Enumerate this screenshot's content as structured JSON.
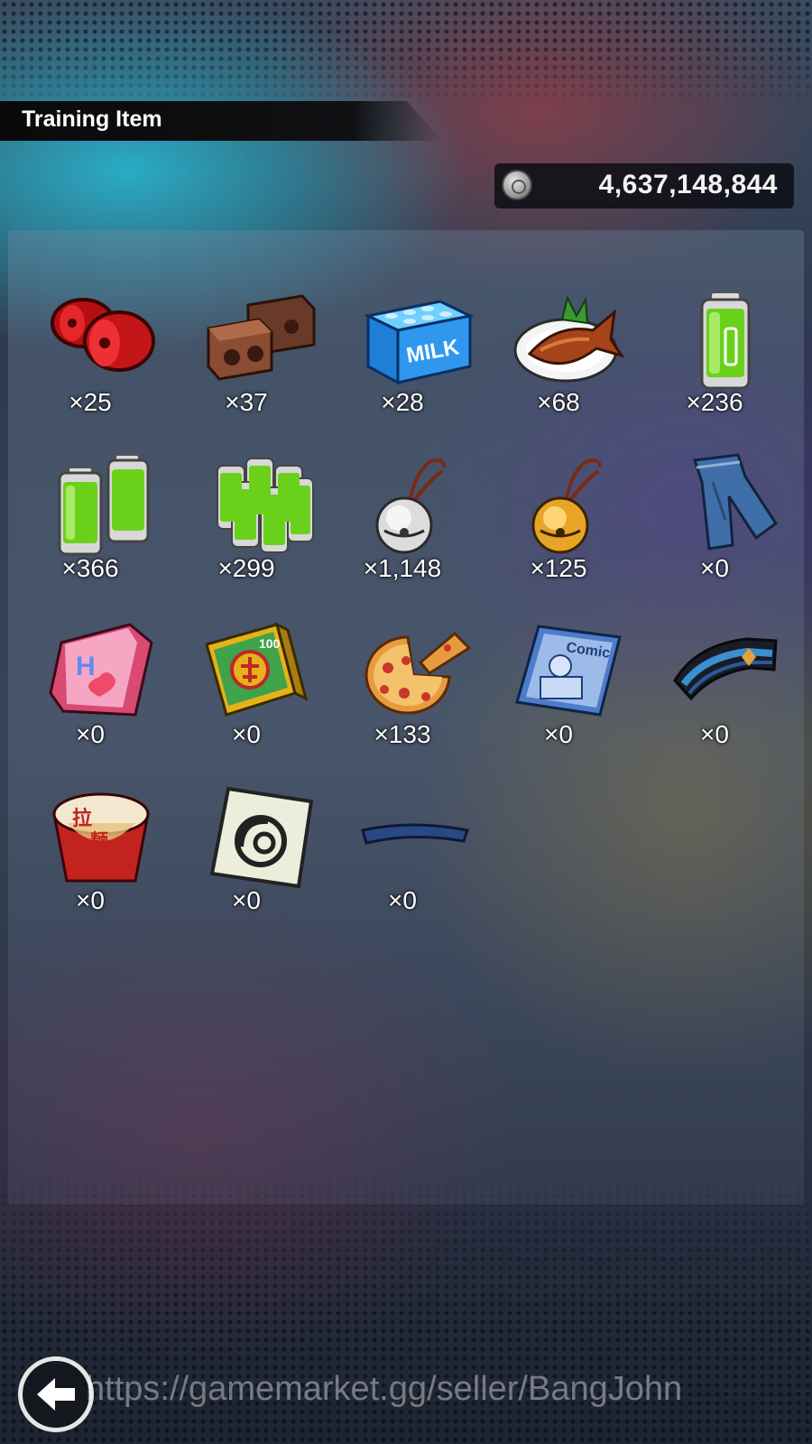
{
  "screen": {
    "title": "Training Item",
    "currency": {
      "icon": "coin-icon",
      "value": "4,637,148,844"
    },
    "watermark": "https://gamemarket.gg/seller/BangJohn",
    "back_icon": "back-arrow-icon"
  },
  "items": [
    {
      "name": "red-weights-icon",
      "count": "×25"
    },
    {
      "name": "brick-weights-icon",
      "count": "×37"
    },
    {
      "name": "milk-carton-icon",
      "count": "×28"
    },
    {
      "name": "grilled-fish-icon",
      "count": "×68"
    },
    {
      "name": "battery-icon",
      "count": "×236"
    },
    {
      "name": "double-battery-icon",
      "count": "×366"
    },
    {
      "name": "battery-pack-icon",
      "count": "×299"
    },
    {
      "name": "silver-bell-icon",
      "count": "×1,148"
    },
    {
      "name": "gold-bell-icon",
      "count": "×125"
    },
    {
      "name": "jeans-icon",
      "count": "×0"
    },
    {
      "name": "love-book-icon",
      "count": "×0"
    },
    {
      "name": "joke-book-icon",
      "count": "×0"
    },
    {
      "name": "pizza-icon",
      "count": "×133"
    },
    {
      "name": "comic-book-icon",
      "count": "×0"
    },
    {
      "name": "wristband-icon",
      "count": "×0"
    },
    {
      "name": "ramen-cup-icon",
      "count": "×0"
    },
    {
      "name": "symbol-card-icon",
      "count": "×0"
    },
    {
      "name": "headband-icon",
      "count": "×0"
    }
  ]
}
